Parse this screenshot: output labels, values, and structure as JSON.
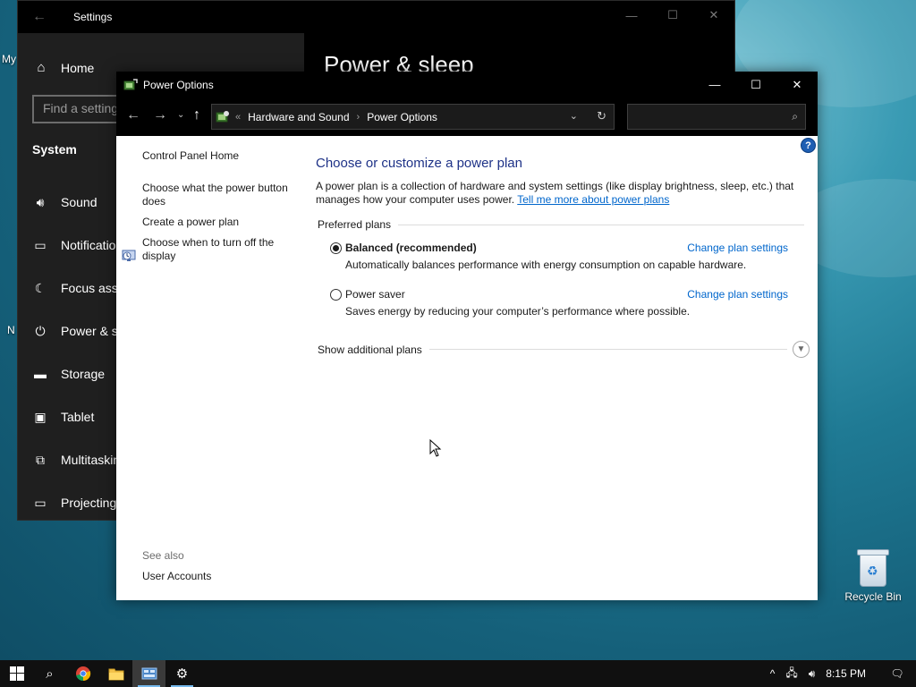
{
  "desktop": {
    "labels": [
      "My",
      "N"
    ],
    "recycle_bin": "Recycle Bin"
  },
  "settings_window": {
    "title": "Settings",
    "heading": "Power & sleep",
    "home": "Home",
    "search_placeholder": "Find a setting",
    "section": "System",
    "nav": [
      {
        "label": "Sound",
        "icon": "speaker-icon"
      },
      {
        "label": "Notificatio",
        "icon": "notification-icon"
      },
      {
        "label": "Focus assis",
        "icon": "moon-icon"
      },
      {
        "label": "Power & sl",
        "icon": "power-icon"
      },
      {
        "label": "Storage",
        "icon": "storage-icon"
      },
      {
        "label": "Tablet",
        "icon": "tablet-icon"
      },
      {
        "label": "Multitaskin",
        "icon": "multitasking-icon"
      },
      {
        "label": "Projecting",
        "icon": "projecting-icon"
      }
    ]
  },
  "power_options": {
    "title": "Power Options",
    "breadcrumb": {
      "overflow": "«",
      "items": [
        "Hardware and Sound",
        "Power Options"
      ]
    },
    "search_value": "",
    "left_links": {
      "home": "Control Panel Home",
      "power_button": "Choose what the power button does",
      "create_plan": "Create a power plan",
      "turn_off_display": "Choose when to turn off the display"
    },
    "see_also": {
      "label": "See also",
      "user_accounts": "User Accounts"
    },
    "main": {
      "heading": "Choose or customize a power plan",
      "desc": "A power plan is a collection of hardware and system settings (like display brightness, sleep, etc.) that manages how your computer uses power.",
      "desc_link": "Tell me more about power plans",
      "preferred": "Preferred plans",
      "plans": [
        {
          "name": "Balanced (recommended)",
          "selected": true,
          "desc": "Automatically balances performance with energy consumption on capable hardware.",
          "change": "Change plan settings"
        },
        {
          "name": "Power saver",
          "selected": false,
          "desc": "Saves energy by reducing your computer’s performance where possible.",
          "change": "Change plan settings"
        }
      ],
      "show_more": "Show additional plans"
    },
    "colors": {
      "heading": "#1e3287",
      "link": "#0066cc",
      "chrome": "#000000"
    }
  },
  "taskbar": {
    "time": "8:15 PM",
    "apps": [
      "windows-start",
      "search",
      "chrome",
      "file-explorer",
      "control-panel",
      "settings"
    ]
  }
}
